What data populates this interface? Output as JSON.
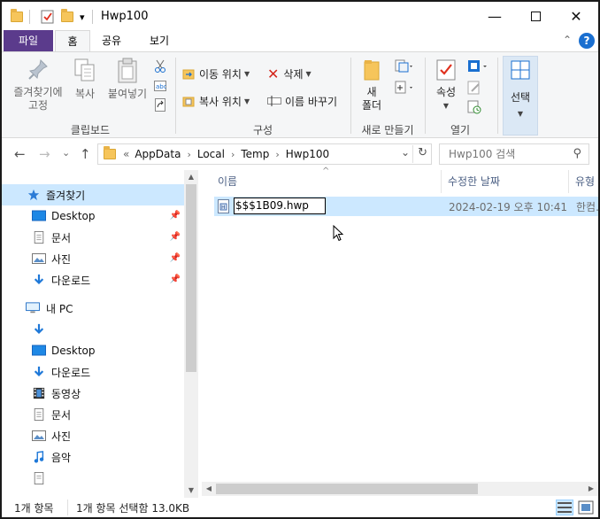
{
  "window": {
    "title": "Hwp100",
    "minimize_glyph": "—",
    "maximize_glyph": "☐",
    "close_glyph": "✕"
  },
  "quick_access": {
    "dropdown_glyph": "▾"
  },
  "ribbon_tabs": [
    "파일",
    "홈",
    "공유",
    "보기"
  ],
  "ribbon_collapse_glyph": "⌃",
  "help_glyph": "?",
  "ribbon": {
    "clipboard": {
      "pin_label_1": "즐겨찾기에",
      "pin_label_2": "고정",
      "copy_label": "복사",
      "paste_label": "붙여넣기",
      "group_label": "클립보드"
    },
    "organize": {
      "move_to": "이동 위치",
      "copy_to": "복사 위치",
      "delete": "삭제",
      "rename": "이름 바꾸기",
      "group_label": "구성"
    },
    "new": {
      "new_folder_1": "새",
      "new_folder_2": "폴더",
      "group_label": "새로 만들기"
    },
    "open": {
      "properties": "속성",
      "group_label": "열기"
    },
    "select": {
      "select_label": "선택"
    }
  },
  "nav": {
    "back": "←",
    "forward": "→",
    "dropdown": "⌄",
    "up": "↑",
    "breadcrumb_prefix": "«",
    "path": [
      "AppData",
      "Local",
      "Temp",
      "Hwp100"
    ],
    "path_dropdown": "⌄",
    "refresh": "↻",
    "search_placeholder": "Hwp100 검색",
    "search_glyph": "⚲"
  },
  "sidebar": {
    "items": [
      {
        "label": "즐겨찾기",
        "icon": "star-icon"
      },
      {
        "label": "Desktop",
        "icon": "desktop-icon"
      },
      {
        "label": "문서",
        "icon": "document-icon"
      },
      {
        "label": "사진",
        "icon": "pictures-icon"
      },
      {
        "label": "다운로드",
        "icon": "download-icon"
      },
      {
        "label": "내 PC",
        "icon": "pc-icon"
      },
      {
        "label": "",
        "icon": "download-icon"
      },
      {
        "label": "Desktop",
        "icon": "desktop-icon"
      },
      {
        "label": "다운로드",
        "icon": "download-icon"
      },
      {
        "label": "동영상",
        "icon": "video-icon"
      },
      {
        "label": "문서",
        "icon": "document-icon"
      },
      {
        "label": "사진",
        "icon": "pictures-icon"
      },
      {
        "label": "음악",
        "icon": "music-icon"
      },
      {
        "label": "",
        "icon": "document-icon"
      }
    ]
  },
  "columns": {
    "name": "이름",
    "date": "수정한 날짜",
    "type": "유형",
    "sort_glyph": "^"
  },
  "files": [
    {
      "name": "$$$1B09.hwp",
      "date": "2024-02-19 오후 10:41",
      "type": "한컴."
    }
  ],
  "status": {
    "count": "1개 항목",
    "selection": "1개 항목 선택함 13.0KB"
  }
}
